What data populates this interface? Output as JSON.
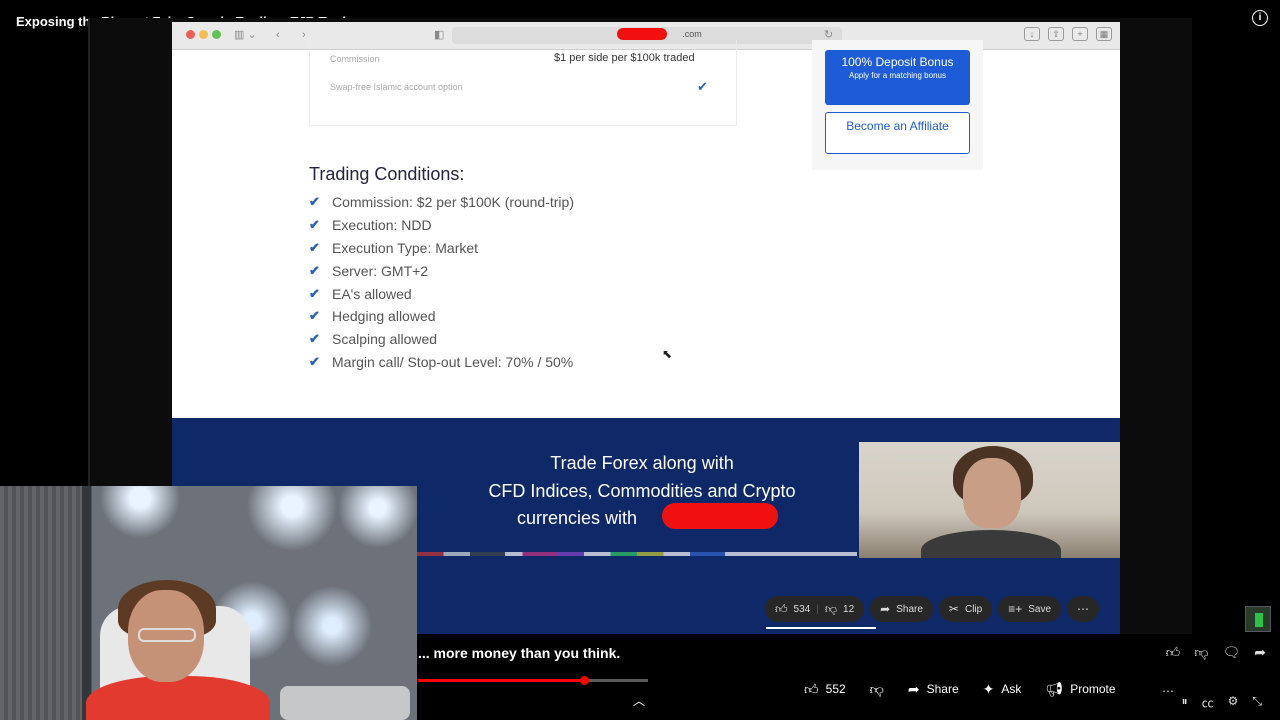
{
  "video": {
    "title": "Exposing the Biggest Fake Guru in Trading: TJR Trades",
    "info_icon": "info-icon"
  },
  "browser": {
    "url_suffix": ".com"
  },
  "spec_box": {
    "commission_label": "Commission",
    "commission_value": "$1 per side per $100k traded",
    "swap_label": "Swap-free Islamic account option",
    "swap_check": "✔"
  },
  "cta": {
    "deposit_title": "100% Deposit Bonus",
    "deposit_sub": "Apply for a matching bonus",
    "affiliate": "Become an Affiliate"
  },
  "trading_conditions": {
    "title": "Trading Conditions:",
    "items": [
      "Commission: $2 per $100K (round-trip)",
      "Execution: NDD",
      "Execution Type: Market",
      "Server: GMT+2",
      "EA's allowed",
      "Hedging allowed",
      "Scalping allowed",
      "Margin call/ Stop-out Level: 70% / 50%"
    ]
  },
  "banner": {
    "line1": "Trade Forex along with",
    "line2": "CFD Indices, Commodities and Crypto",
    "line3": "currencies with"
  },
  "inner_actions": {
    "likes": "534",
    "dislikes": "12",
    "share": "Share",
    "clip": "Clip",
    "save": "Save"
  },
  "caption": "... more money than you think.",
  "player": {
    "progress_fraction": 0.72
  },
  "outer_actions": {
    "likes": "552",
    "share": "Share",
    "ask": "Ask",
    "promote": "Promote"
  }
}
